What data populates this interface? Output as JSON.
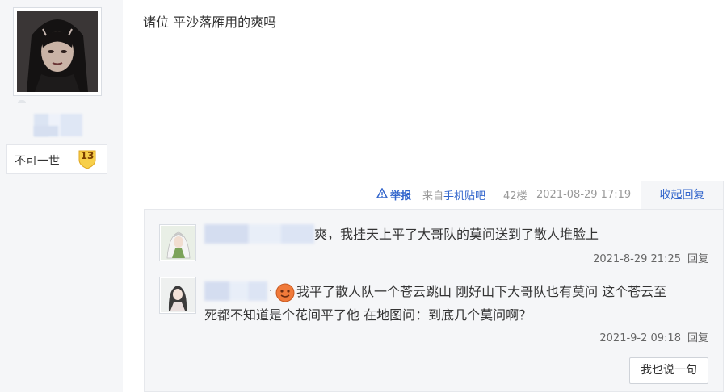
{
  "author": {
    "level_title": "不可一世",
    "level_number": "13"
  },
  "post": {
    "content": "诸位 平沙落雁用的爽吗",
    "report_label": "举报",
    "source_prefix": "来自",
    "source_link": "手机贴吧",
    "floor": "42楼",
    "datetime": "2021-08-29 17:19",
    "collapse_label": "收起回复"
  },
  "replies": [
    {
      "text": "爽，我挂天上平了大哥队的莫问送到了散人堆脸上",
      "datetime": "2021-8-29 21:25",
      "reply_label": "回复"
    },
    {
      "dot": ".",
      "text_line1": "我平了散人队一个苍云跳山 刚好山下大哥队也有莫问 这个苍云至",
      "text_line2": "死都不知道是个花间平了他 在地图问：到底几个莫问啊？",
      "datetime": "2021-9-2 09:18",
      "reply_label": "回复"
    }
  ],
  "say_button_label": "我也说一句",
  "colors": {
    "link": "#3366cc",
    "sidebar_bg": "#f5f6f8",
    "panel_bg": "#f5f6f8",
    "badge": "#f5c842"
  }
}
